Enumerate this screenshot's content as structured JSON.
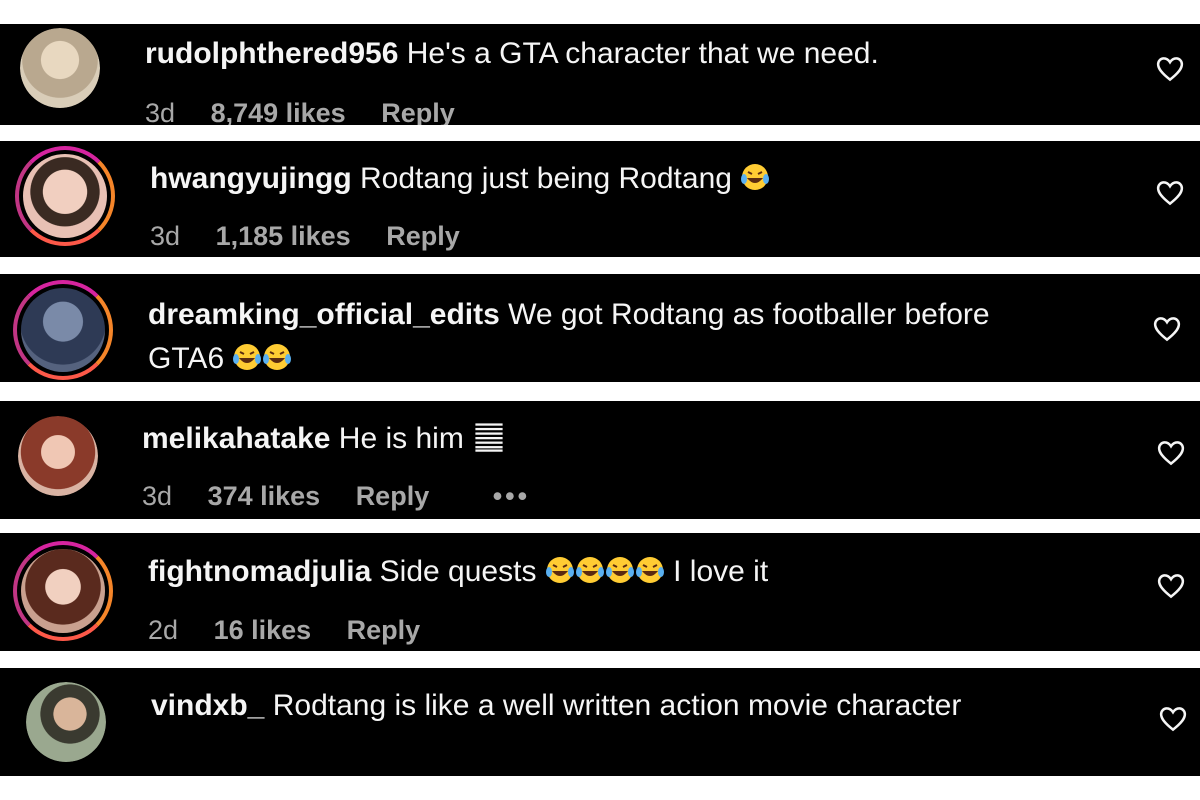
{
  "comments": [
    {
      "username": "rudolphthered956",
      "text": "He's a GTA character that we need.",
      "time": "3d",
      "likes": "8,749 likes",
      "reply": "Reply",
      "avatar_color": "#c8b8a0"
    },
    {
      "username": "hwangyujingg",
      "text": "Rodtang just being Rodtang",
      "time": "3d",
      "likes": "1,185 likes",
      "reply": "Reply",
      "avatar_color": "#e6b7a9"
    },
    {
      "username": "dreamking_official_edits",
      "text": "We got Rodtang as footballer before GTA6",
      "time": "",
      "likes": "",
      "reply": "",
      "avatar_color": "#4a5a7a"
    },
    {
      "username": "melikahatake",
      "text": "He is him",
      "time": "3d",
      "likes": "374 likes",
      "reply": "Reply",
      "more": "•••",
      "avatar_color": "#b06a5a"
    },
    {
      "username": "fightnomadjulia",
      "text": "Side quests",
      "text2": "I love it",
      "time": "2d",
      "likes": "16 likes",
      "reply": "Reply",
      "avatar_color": "#8a4a3a"
    },
    {
      "username": "vindxb_",
      "text": "Rodtang is like a well written action movie character",
      "time": "",
      "likes": "",
      "reply": "",
      "avatar_color": "#6a7a6a"
    }
  ],
  "icons": {
    "like": "heart-outline-icon",
    "emoji": "laughing-tears-emoji-icon",
    "flag": "striped-flag-icon",
    "more": "more-dots-icon"
  },
  "colors": {
    "strip": "#000000",
    "text": "#f5f5f5",
    "meta": "#a8a8a8",
    "story_ring": "#d6249f"
  }
}
